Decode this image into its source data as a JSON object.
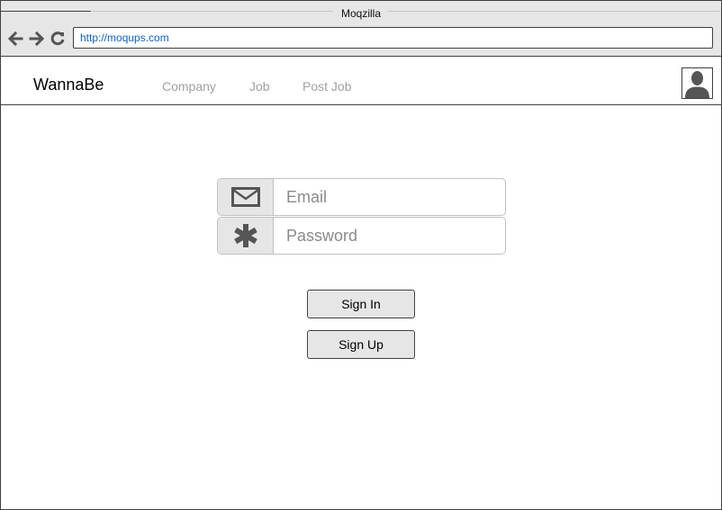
{
  "browser": {
    "title": "Moqzilla",
    "url": "http://moqups.com",
    "icons": [
      "back-arrow-icon",
      "forward-arrow-icon",
      "reload-icon"
    ]
  },
  "app": {
    "brand": "WannaBe",
    "nav": [
      {
        "label": "Company"
      },
      {
        "label": "Job"
      },
      {
        "label": "Post Job"
      }
    ],
    "avatar_icon": "user-silhouette-icon"
  },
  "login": {
    "email": {
      "placeholder": "Email",
      "value": "",
      "icon": "envelope-icon"
    },
    "password": {
      "placeholder": "Password",
      "value": "",
      "icon": "asterisk-icon"
    },
    "sign_in_label": "Sign In",
    "sign_up_label": "Sign Up"
  },
  "colors": {
    "chrome_bg": "#e6e6e6",
    "border": "#404040",
    "url_text": "#0a62c9",
    "nav_text": "#a0a0a0",
    "icon_fill": "#555555"
  }
}
